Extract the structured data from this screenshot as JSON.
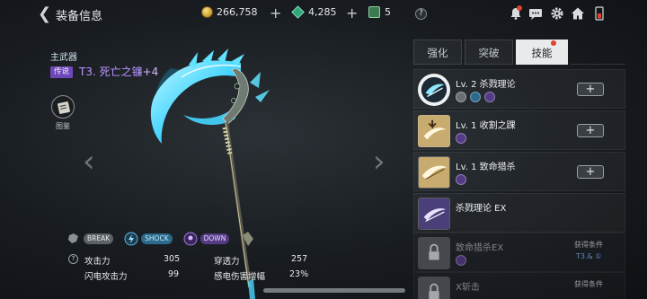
{
  "header": {
    "title": "装备信息"
  },
  "currency": {
    "gold": "266,758",
    "gems": "4,285",
    "scrolls": "5"
  },
  "weapon": {
    "slot_label": "主武器",
    "grade": "传说",
    "name": "T3. 死亡之镰",
    "enhance": "+4",
    "atlas_label": "图鉴"
  },
  "tags": [
    "BREAK",
    "SHOCK",
    "DOWN"
  ],
  "stats": {
    "atk_label": "攻击力",
    "atk_value": "305",
    "pen_label": "穿透力",
    "pen_value": "257",
    "lightning_label": "闪电攻击力",
    "lightning_value": "99",
    "shock_label": "感电伤害增幅",
    "shock_value": "23%"
  },
  "tabs": [
    "强化",
    "突破",
    "技能"
  ],
  "active_tab": "技能",
  "skills": [
    {
      "name": "Lv. 2 杀戮理论",
      "action": "+"
    },
    {
      "name": "Lv. 1 收割之踝",
      "action": "+"
    },
    {
      "name": "Lv. 1 致命猎杀",
      "action": "+"
    },
    {
      "name": "杀戮理论 EX"
    },
    {
      "name": "致命猎杀EX",
      "cond_label": "获得条件",
      "cond_value": "T3.& ①"
    },
    {
      "name": "X斩击",
      "cond_label": "获得条件"
    }
  ],
  "colors": {
    "accent_purple": "#b995ff",
    "grade_bg": "#6e47b8",
    "skill_cyan": "#5fe3ff",
    "notify_red": "#e0422d"
  }
}
